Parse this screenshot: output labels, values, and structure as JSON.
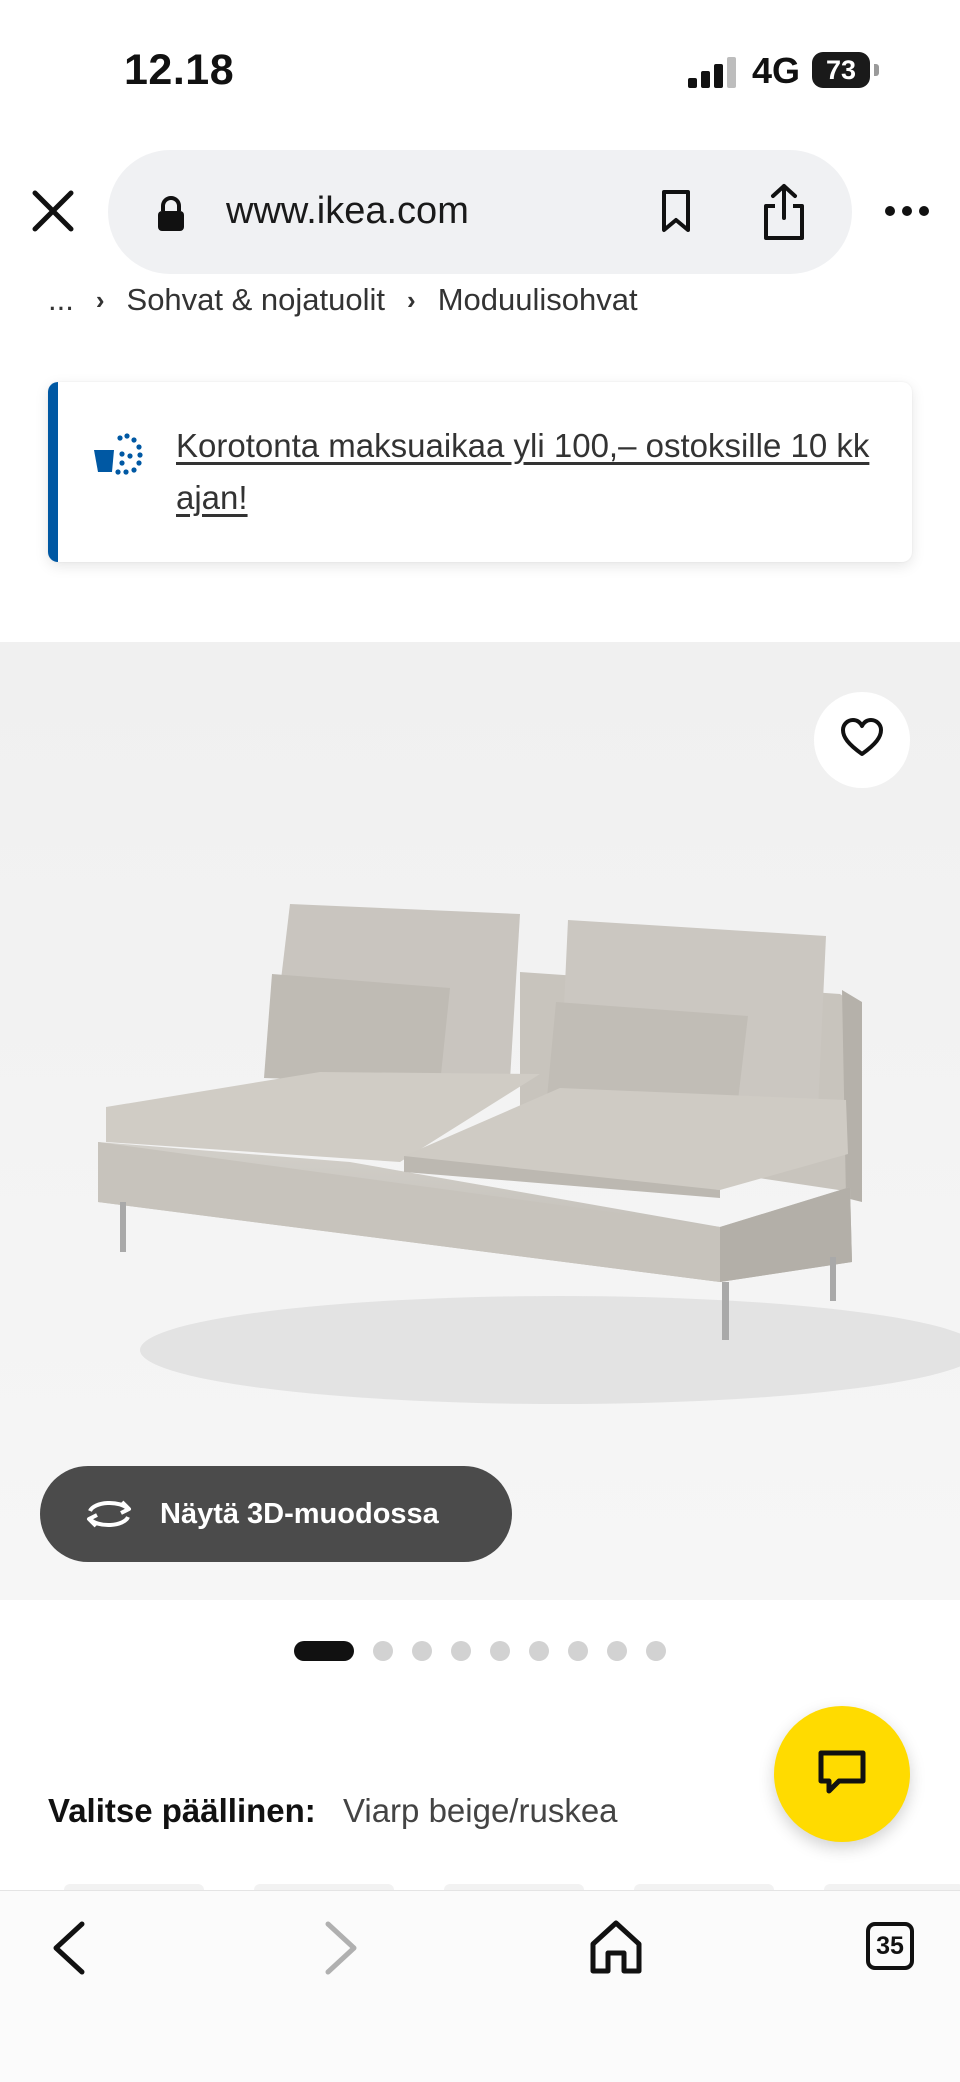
{
  "status_bar": {
    "time": "12.18",
    "network": "4G",
    "battery": "73"
  },
  "browser": {
    "url": "www.ikea.com",
    "tab_count": "35"
  },
  "breadcrumb": {
    "ellipsis": "...",
    "items": [
      "Sohvat & nojatuolit",
      "Moduulisohvat"
    ]
  },
  "promo": {
    "text": "Korotonta maksuaikaa yli 100,– ostoksille 10 kk ajan!",
    "accent": "#0058a3"
  },
  "product": {
    "view_3d_label": "Näytä 3D-muodossa",
    "image_count": 9,
    "active_image": 1,
    "cover_label": "Valitse päällinen:",
    "cover_value": "Viarp beige/ruskea"
  },
  "colors": {
    "chat": "#ffdb00",
    "button_dark": "#4b4b4b"
  },
  "icons": [
    "close-icon",
    "lock-icon",
    "bookmark-icon",
    "share-icon",
    "more-icon",
    "chevron-right-icon",
    "installment-icon",
    "heart-icon",
    "rotate-3d-icon",
    "chat-icon",
    "back-icon",
    "forward-icon",
    "home-icon",
    "tabs-icon"
  ]
}
